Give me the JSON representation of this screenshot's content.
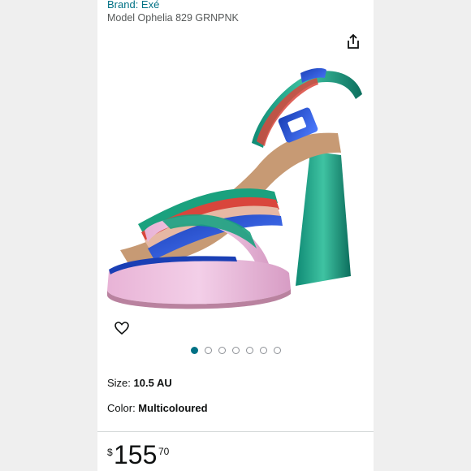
{
  "product": {
    "brand": "Brand: Exé",
    "model": "Model Ophelia 829 GRNPNK"
  },
  "gallery": {
    "image_count": 7,
    "active_index": 0
  },
  "details": {
    "size_label": "Size: ",
    "size_value": "10.5 AU",
    "color_label": "Color: ",
    "color_value": "Multicoloured"
  },
  "price": {
    "symbol": "$",
    "whole": "155",
    "fraction": "70"
  },
  "icons": {
    "share": "share-icon",
    "wishlist": "heart-icon"
  },
  "colors": {
    "link": "#007185",
    "text": "#0f1111",
    "muted": "#565959",
    "background": "#efefef"
  }
}
